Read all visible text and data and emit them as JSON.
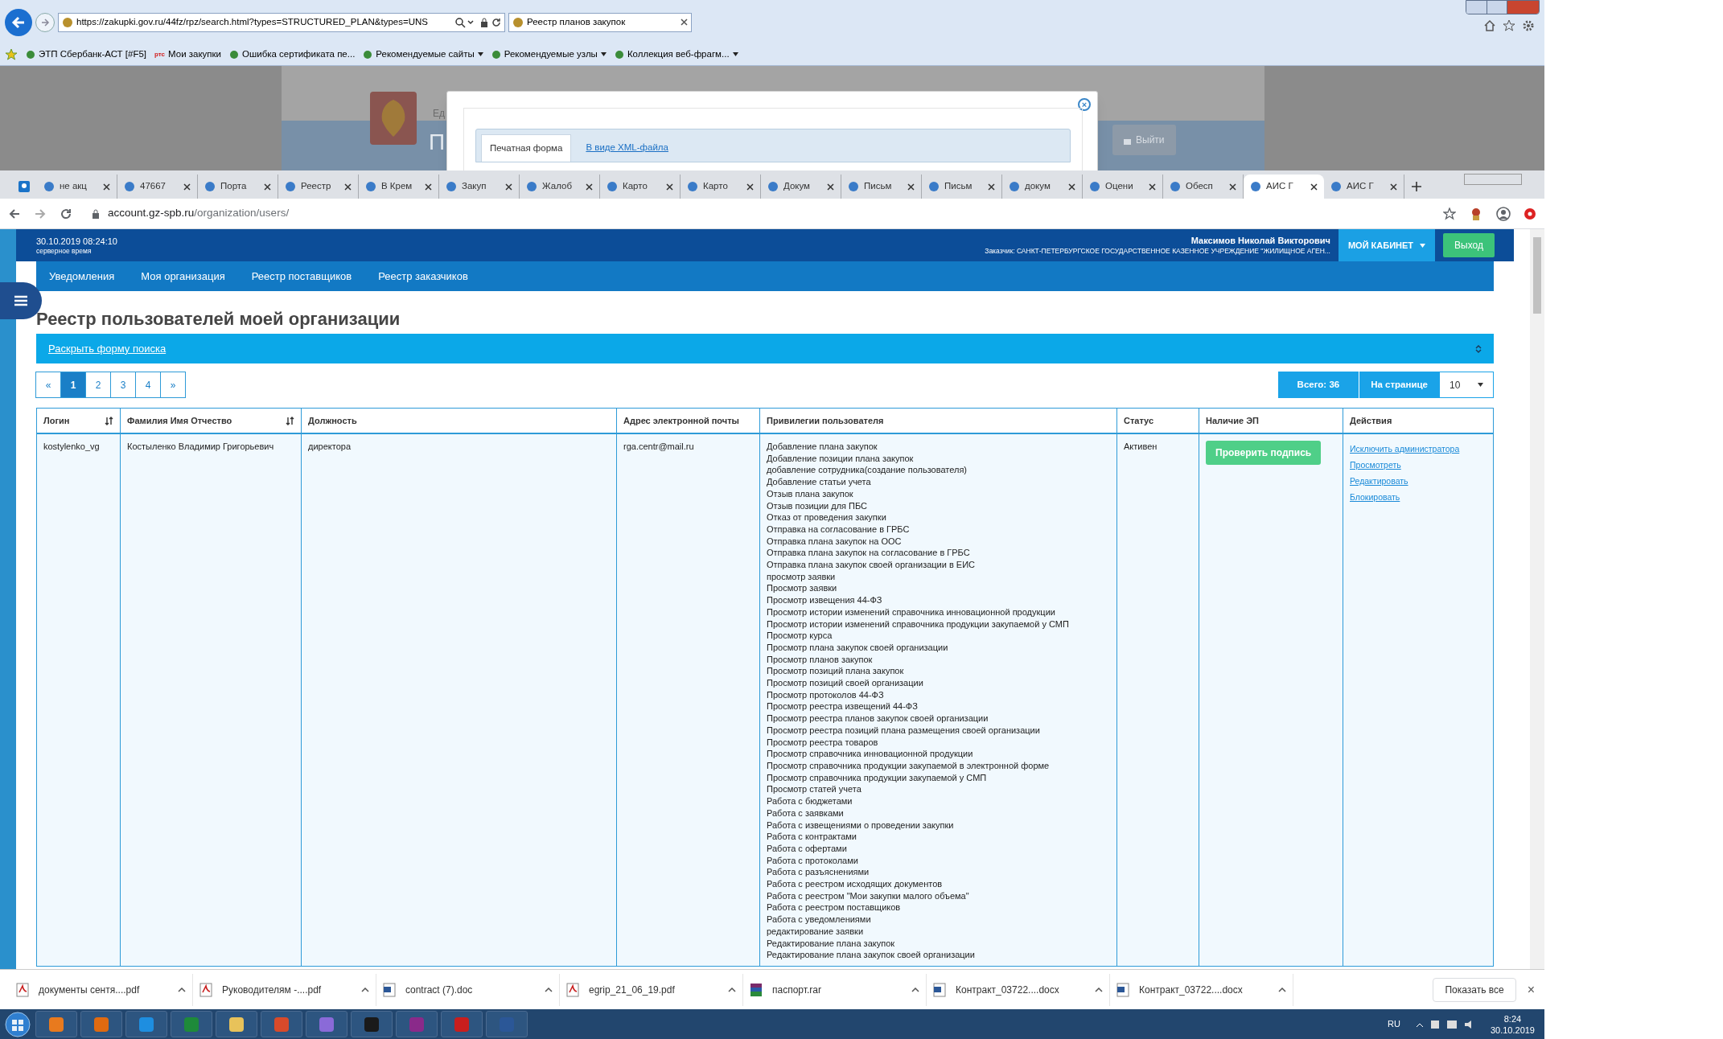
{
  "ie_window": {
    "address": "https://zakupki.gov.ru/44fz/rpz/search.html?types=STRUCTURED_PLAN&types=UNS",
    "tab": "Реестр планов закупок",
    "favorites": [
      {
        "label": "ЭТП Сбербанк-АСТ [#F5]",
        "dropdown": false
      },
      {
        "badge": "ртс",
        "label": "Мои закупки",
        "dropdown": false
      },
      {
        "label": "Ошибка сертификата пе...",
        "dropdown": false
      },
      {
        "label": "Рекомендуемые сайты",
        "dropdown": true
      },
      {
        "label": "Рекомендуемые узлы",
        "dropdown": true
      },
      {
        "label": "Коллекция веб-фрагм...",
        "dropdown": true
      }
    ]
  },
  "background_page": {
    "header_fragment": "Ед",
    "title_fragment": "П",
    "logout_button": "Выйти"
  },
  "dialog": {
    "close": "×",
    "tabs": [
      {
        "label": "Печатная форма",
        "selected": true
      },
      {
        "label": "В виде XML-файла",
        "selected": false
      }
    ]
  },
  "browser": {
    "url_host": "account.gz-spb.ru",
    "url_path": "/organization/users/",
    "tabs": [
      {
        "label": "не акц",
        "selected": false
      },
      {
        "label": "47667",
        "selected": false
      },
      {
        "label": "Порта",
        "selected": false
      },
      {
        "label": "Реестр",
        "selected": false
      },
      {
        "label": "В Крем",
        "selected": false
      },
      {
        "label": "Закуп",
        "selected": false
      },
      {
        "label": "Жалоб",
        "selected": false
      },
      {
        "label": "Карто",
        "selected": false
      },
      {
        "label": "Карто",
        "selected": false
      },
      {
        "label": "Докум",
        "selected": false
      },
      {
        "label": "Письм",
        "selected": false
      },
      {
        "label": "Письм",
        "selected": false
      },
      {
        "label": "докум",
        "selected": false
      },
      {
        "label": "Оцени",
        "selected": false
      },
      {
        "label": "Обесп",
        "selected": false
      },
      {
        "label": "АИС Г",
        "selected": true
      },
      {
        "label": "АИС Г",
        "selected": false
      }
    ]
  },
  "header": {
    "datetime": "30.10.2019 08:24:10",
    "datetime_caption": "серверное время",
    "user": "Максимов Николай Викторович",
    "customer": "Заказчик: САНКТ-ПЕТЕРБУРГСКОЕ ГОСУДАРСТВЕННОЕ КАЗЕННОЕ УЧРЕЖДЕНИЕ \"ЖИЛИЩНОЕ АГЕН...",
    "cabinet_button": "МОЙ КАБИНЕТ",
    "logout_button": "Выход"
  },
  "nav": [
    "Уведомления",
    "Моя организация",
    "Реестр поставщиков",
    "Реестр заказчиков"
  ],
  "page_title": "Реестр пользователей моей организации",
  "search_toggle": "Раскрыть форму поиска",
  "pagination": [
    {
      "label": "«",
      "selected": false
    },
    {
      "label": "1",
      "selected": true
    },
    {
      "label": "2",
      "selected": false
    },
    {
      "label": "3",
      "selected": false
    },
    {
      "label": "4",
      "selected": false
    },
    {
      "label": "»",
      "selected": false
    }
  ],
  "total": "Всего: 36",
  "per_page_label": "На странице",
  "per_page_value": "10",
  "table": {
    "columns": [
      {
        "label": "Логин",
        "sortable": true
      },
      {
        "label": "Фамилия Имя Отчество",
        "sortable": true
      },
      {
        "label": "Должность",
        "sortable": false
      },
      {
        "label": "Адрес электронной почты",
        "sortable": false
      },
      {
        "label": "Привилегии пользователя",
        "sortable": false
      },
      {
        "label": "Статус",
        "sortable": false
      },
      {
        "label": "Наличие ЭП",
        "sortable": false
      },
      {
        "label": "Действия",
        "sortable": false
      }
    ],
    "rows": [
      {
        "login": "kostylenko_vg",
        "full_name": "Костыленко Владимир Григорьевич",
        "position": "директора",
        "email": "rga.centr@mail.ru",
        "privileges": [
          "Добавление плана закупок",
          "Добавление позиции плана закупок",
          "добавление сотрудника(создание пользователя)",
          "Добавление статьи учета",
          "Отзыв плана закупок",
          "Отзыв позиции для ПБС",
          "Отказ от проведения закупки",
          "Отправка на согласование в ГРБС",
          "Отправка плана закупок на ООС",
          "Отправка плана закупок на согласование в ГРБС",
          "Отправка плана закупок своей организации в ЕИС",
          "просмотр заявки",
          "Просмотр заявки",
          "Просмотр извещения 44-ФЗ",
          "Просмотр истории изменений справочника инновационной продукции",
          "Просмотр истории изменений справочника продукции закупаемой у СМП",
          "Просмотр курса",
          "Просмотр плана закупок своей организации",
          "Просмотр планов закупок",
          "Просмотр позиций плана закупок",
          "Просмотр позиций своей организации",
          "Просмотр протоколов 44-ФЗ",
          "Просмотр реестра извещений 44-ФЗ",
          "Просмотр реестра планов закупок своей организации",
          "Просмотр реестра позиций плана размещения своей организации",
          "Просмотр реестра товаров",
          "Просмотр справочника инновационной продукции",
          "Просмотр справочника продукции закупаемой в электронной форме",
          "Просмотр справочника продукции закупаемой у СМП",
          "Просмотр статей учета",
          "Работа с бюджетами",
          "Работа с заявками",
          "Работа с извещениями о проведении закупки",
          "Работа с контрактами",
          "Работа с офертами",
          "Работа с протоколами",
          "Работа с разъяснениями",
          "Работа с реестром исходящих документов",
          "Работа с реестром \"Мои закупки малого объема\"",
          "Работа с реестром поставщиков",
          "Работа с уведомлениями",
          "редактирование заявки",
          "Редактирование плана закупок",
          "Редактирование плана закупок своей организации"
        ],
        "status": "Активен",
        "signature_button": "Проверить подпись",
        "actions": [
          "Исключить администратора",
          "Просмотреть",
          "Редактировать",
          "Блокировать"
        ]
      }
    ]
  },
  "downloads": {
    "items": [
      {
        "name": "документы сентя....pdf",
        "kind": "pdf"
      },
      {
        "name": "Руководителям -....pdf",
        "kind": "pdf"
      },
      {
        "name": "contract (7).doc",
        "kind": "doc"
      },
      {
        "name": "egrip_21_06_19.pdf",
        "kind": "pdf"
      },
      {
        "name": "паспорт.rar",
        "kind": "rar"
      },
      {
        "name": "Контракт_03722....docx",
        "kind": "doc"
      },
      {
        "name": "Контракт_03722....docx",
        "kind": "doc"
      }
    ],
    "show_all": "Показать все",
    "close": "×"
  },
  "taskbar": {
    "language": "RU",
    "time": "8:24",
    "date": "30.10.2019"
  }
}
